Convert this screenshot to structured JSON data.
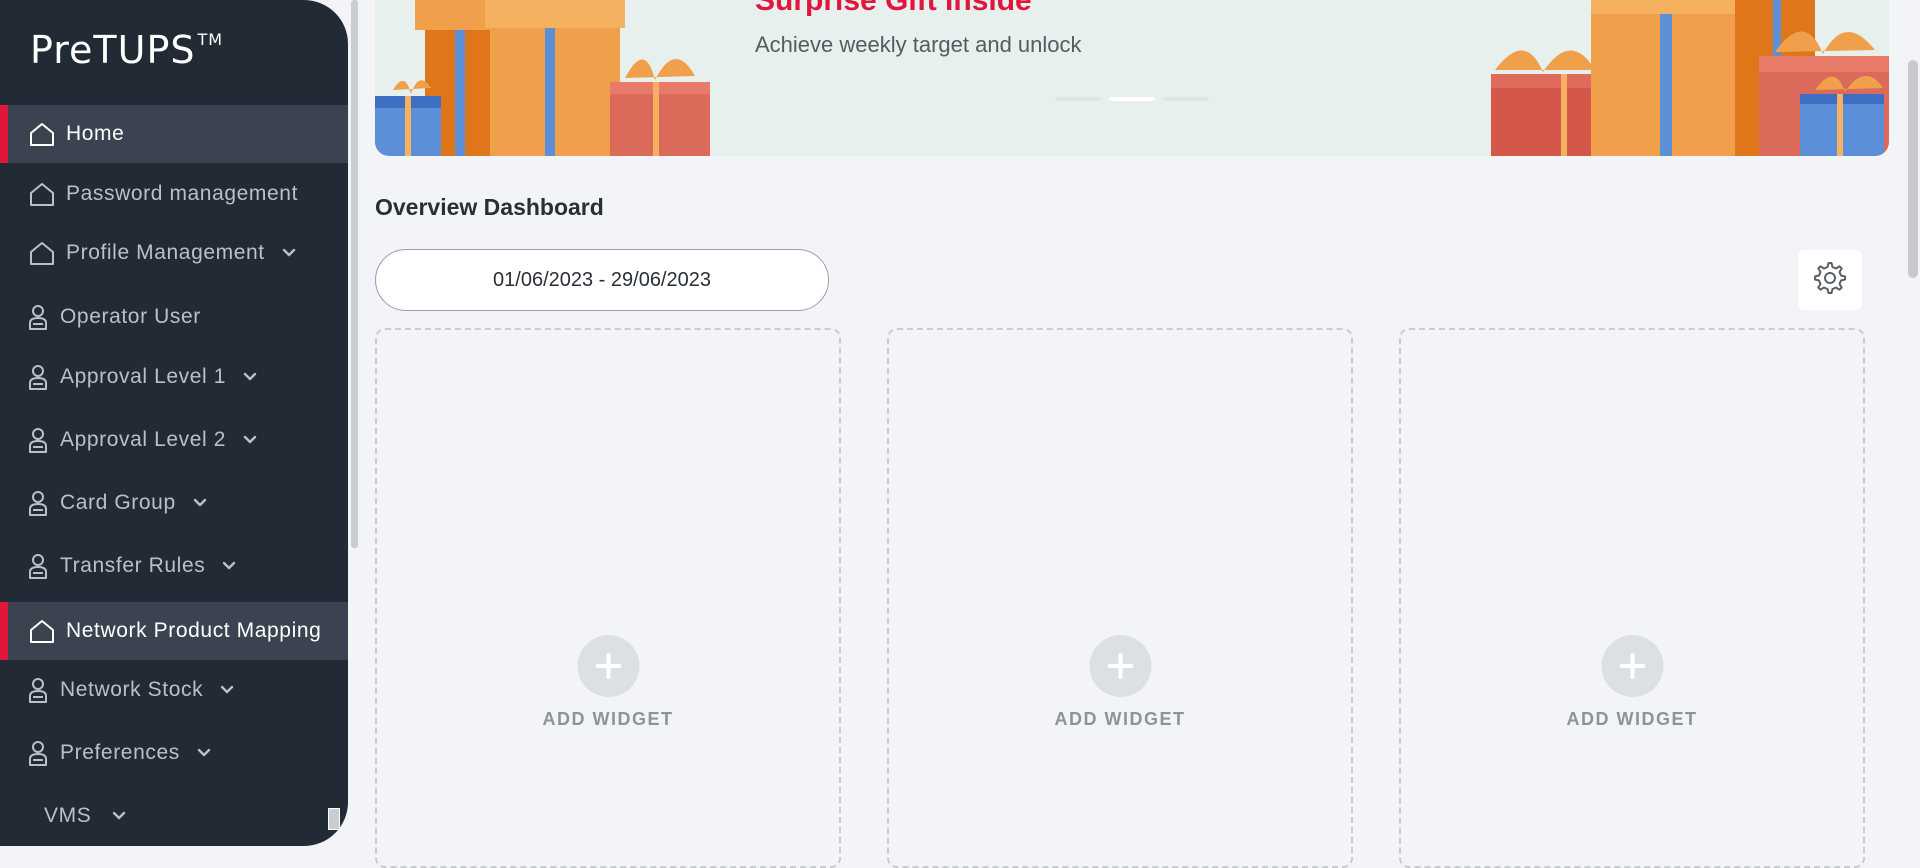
{
  "app": {
    "logo_text": "PreTUPS",
    "logo_tm": "TM"
  },
  "sidebar": {
    "items": [
      {
        "label": "Home",
        "icon": "home-icon",
        "active": true,
        "expandable": false
      },
      {
        "label": "Password management",
        "icon": "home-icon",
        "active": false,
        "expandable": false
      },
      {
        "label": "Profile Management",
        "icon": "home-icon",
        "active": false,
        "expandable": true
      },
      {
        "label": "Operator User",
        "icon": "user-icon",
        "active": false,
        "expandable": false
      },
      {
        "label": "Approval Level 1",
        "icon": "user-icon",
        "active": false,
        "expandable": true
      },
      {
        "label": "Approval Level 2",
        "icon": "user-icon",
        "active": false,
        "expandable": true
      },
      {
        "label": "Card Group",
        "icon": "user-icon",
        "active": false,
        "expandable": true
      },
      {
        "label": "Transfer Rules",
        "icon": "user-icon",
        "active": false,
        "expandable": true
      },
      {
        "label": "Network Product Mapping",
        "icon": "home-icon",
        "active": true,
        "expandable": false
      },
      {
        "label": "Network Stock",
        "icon": "user-icon",
        "active": false,
        "expandable": true
      },
      {
        "label": "Preferences",
        "icon": "user-icon",
        "active": false,
        "expandable": true
      },
      {
        "label": "VMS",
        "icon": "",
        "active": false,
        "expandable": true
      }
    ]
  },
  "banner": {
    "title": "Surprise Gift Inside",
    "subtitle": "Achieve weekly target and unlock",
    "slides": 3,
    "active_slide": 1
  },
  "dashboard": {
    "title": "Overview Dashboard",
    "date_range": "01/06/2023 - 29/06/2023",
    "settings_icon": "gear-icon",
    "widgets": [
      {
        "label": "ADD WIDGET"
      },
      {
        "label": "ADD WIDGET"
      },
      {
        "label": "ADD WIDGET"
      }
    ]
  },
  "colors": {
    "sidebar_bg": "#212a35",
    "accent": "#e0163c",
    "banner_bg": "#e7f0ec",
    "page_bg": "#f3f4f7"
  }
}
